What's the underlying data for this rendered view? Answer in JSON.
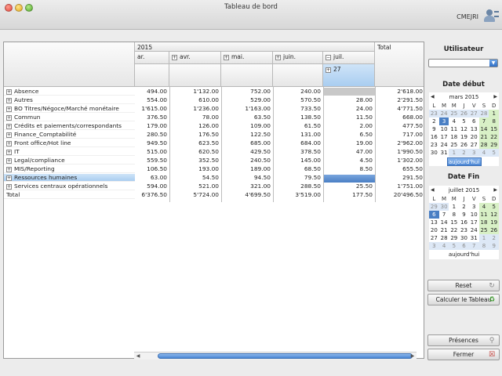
{
  "window": {
    "title": "Tableau de bord",
    "user": "CMEJRI"
  },
  "pivot": {
    "year": "2015",
    "total_label": "Total",
    "months": [
      "ar.",
      "avr.",
      "mai.",
      "juin.",
      "juil."
    ],
    "juil_sub": "27",
    "rows": [
      {
        "label": "Absence",
        "vals": [
          "494.00",
          "1'132.00",
          "752.00",
          "240.00",
          ""
        ],
        "total": "2'618.00"
      },
      {
        "label": "Autres",
        "vals": [
          "554.00",
          "610.00",
          "529.00",
          "570.50",
          "28.00"
        ],
        "total": "2'291.50"
      },
      {
        "label": "BO Titres/Négoce/Marché monétaire",
        "vals": [
          "1'615.00",
          "1'236.00",
          "1'163.00",
          "733.50",
          "24.00"
        ],
        "total": "4'771.50"
      },
      {
        "label": "Commun",
        "vals": [
          "376.50",
          "78.00",
          "63.50",
          "138.50",
          "11.50"
        ],
        "total": "668.00"
      },
      {
        "label": "Crédits et paiements/correspondants",
        "vals": [
          "179.00",
          "126.00",
          "109.00",
          "61.50",
          "2.00"
        ],
        "total": "477.50"
      },
      {
        "label": "Finance_Comptabilité",
        "vals": [
          "280.50",
          "176.50",
          "122.50",
          "131.00",
          "6.50"
        ],
        "total": "717.00"
      },
      {
        "label": "Front office/Hot line",
        "vals": [
          "949.50",
          "623.50",
          "685.00",
          "684.00",
          "19.00"
        ],
        "total": "2'962.00"
      },
      {
        "label": "IT",
        "vals": [
          "515.00",
          "620.50",
          "429.50",
          "378.50",
          "47.00"
        ],
        "total": "1'990.50"
      },
      {
        "label": "Legal/compliance",
        "vals": [
          "559.50",
          "352.50",
          "240.50",
          "145.00",
          "4.50"
        ],
        "total": "1'302.00"
      },
      {
        "label": "MIS/Reporting",
        "vals": [
          "106.50",
          "193.00",
          "189.00",
          "68.50",
          "8.50"
        ],
        "total": "655.50"
      },
      {
        "label": "Ressources humaines",
        "vals": [
          "63.00",
          "54.50",
          "94.50",
          "79.50",
          ""
        ],
        "total": "291.50"
      },
      {
        "label": "Services centraux opérationnels",
        "vals": [
          "594.00",
          "521.00",
          "321.00",
          "288.50",
          "25.50"
        ],
        "total": "1'751.00"
      }
    ],
    "grand_total": {
      "label": "Total",
      "vals": [
        "6'376.50",
        "5'724.00",
        "4'699.50",
        "3'519.00",
        "177.50"
      ],
      "total": "20'496.50"
    }
  },
  "sidebar": {
    "user_title": "Utilisateur",
    "start_title": "Date début",
    "end_title": "Date Fin",
    "cal1": {
      "month": "mars 2015",
      "dow": [
        "L",
        "M",
        "M",
        "J",
        "V",
        "S",
        "D"
      ],
      "weeks": [
        [
          "23",
          "24",
          "25",
          "26",
          "27",
          "28",
          "1"
        ],
        [
          "2",
          "3",
          "4",
          "5",
          "6",
          "7",
          "8"
        ],
        [
          "9",
          "10",
          "11",
          "12",
          "13",
          "14",
          "15"
        ],
        [
          "16",
          "17",
          "18",
          "19",
          "20",
          "21",
          "22"
        ],
        [
          "23",
          "24",
          "25",
          "26",
          "27",
          "28",
          "29"
        ],
        [
          "30",
          "31",
          "1",
          "2",
          "3",
          "4",
          "5"
        ]
      ],
      "today": "aujourd'hui"
    },
    "cal2": {
      "month": "juillet 2015",
      "dow": [
        "L",
        "M",
        "M",
        "J",
        "V",
        "S",
        "D"
      ],
      "weeks": [
        [
          "29",
          "30",
          "1",
          "2",
          "3",
          "4",
          "5"
        ],
        [
          "6",
          "7",
          "8",
          "9",
          "10",
          "11",
          "12"
        ],
        [
          "13",
          "14",
          "15",
          "16",
          "17",
          "18",
          "19"
        ],
        [
          "20",
          "21",
          "22",
          "23",
          "24",
          "25",
          "26"
        ],
        [
          "27",
          "28",
          "29",
          "30",
          "31",
          "1",
          "2"
        ],
        [
          "3",
          "4",
          "5",
          "6",
          "7",
          "8",
          "9"
        ]
      ],
      "today": "aujourd'hui"
    },
    "buttons": {
      "reset": "Reset",
      "calc": "Calculer le Tableau",
      "presences": "Présences",
      "close": "Fermer"
    }
  }
}
